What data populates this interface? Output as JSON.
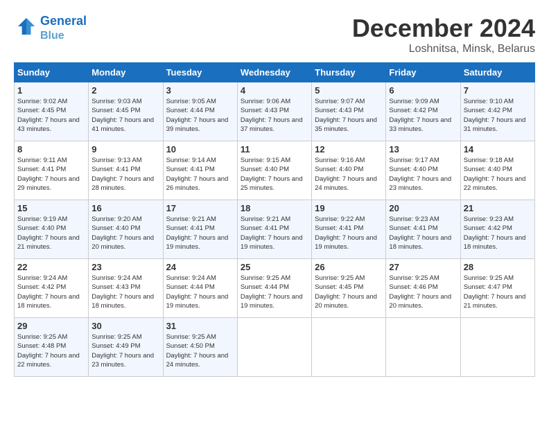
{
  "header": {
    "logo_line1": "General",
    "logo_line2": "Blue",
    "month": "December 2024",
    "location": "Loshnitsa, Minsk, Belarus"
  },
  "weekdays": [
    "Sunday",
    "Monday",
    "Tuesday",
    "Wednesday",
    "Thursday",
    "Friday",
    "Saturday"
  ],
  "weeks": [
    [
      {
        "day": "1",
        "sunrise": "Sunrise: 9:02 AM",
        "sunset": "Sunset: 4:45 PM",
        "daylight": "Daylight: 7 hours and 43 minutes."
      },
      {
        "day": "2",
        "sunrise": "Sunrise: 9:03 AM",
        "sunset": "Sunset: 4:45 PM",
        "daylight": "Daylight: 7 hours and 41 minutes."
      },
      {
        "day": "3",
        "sunrise": "Sunrise: 9:05 AM",
        "sunset": "Sunset: 4:44 PM",
        "daylight": "Daylight: 7 hours and 39 minutes."
      },
      {
        "day": "4",
        "sunrise": "Sunrise: 9:06 AM",
        "sunset": "Sunset: 4:43 PM",
        "daylight": "Daylight: 7 hours and 37 minutes."
      },
      {
        "day": "5",
        "sunrise": "Sunrise: 9:07 AM",
        "sunset": "Sunset: 4:43 PM",
        "daylight": "Daylight: 7 hours and 35 minutes."
      },
      {
        "day": "6",
        "sunrise": "Sunrise: 9:09 AM",
        "sunset": "Sunset: 4:42 PM",
        "daylight": "Daylight: 7 hours and 33 minutes."
      },
      {
        "day": "7",
        "sunrise": "Sunrise: 9:10 AM",
        "sunset": "Sunset: 4:42 PM",
        "daylight": "Daylight: 7 hours and 31 minutes."
      }
    ],
    [
      {
        "day": "8",
        "sunrise": "Sunrise: 9:11 AM",
        "sunset": "Sunset: 4:41 PM",
        "daylight": "Daylight: 7 hours and 29 minutes."
      },
      {
        "day": "9",
        "sunrise": "Sunrise: 9:13 AM",
        "sunset": "Sunset: 4:41 PM",
        "daylight": "Daylight: 7 hours and 28 minutes."
      },
      {
        "day": "10",
        "sunrise": "Sunrise: 9:14 AM",
        "sunset": "Sunset: 4:41 PM",
        "daylight": "Daylight: 7 hours and 26 minutes."
      },
      {
        "day": "11",
        "sunrise": "Sunrise: 9:15 AM",
        "sunset": "Sunset: 4:40 PM",
        "daylight": "Daylight: 7 hours and 25 minutes."
      },
      {
        "day": "12",
        "sunrise": "Sunrise: 9:16 AM",
        "sunset": "Sunset: 4:40 PM",
        "daylight": "Daylight: 7 hours and 24 minutes."
      },
      {
        "day": "13",
        "sunrise": "Sunrise: 9:17 AM",
        "sunset": "Sunset: 4:40 PM",
        "daylight": "Daylight: 7 hours and 23 minutes."
      },
      {
        "day": "14",
        "sunrise": "Sunrise: 9:18 AM",
        "sunset": "Sunset: 4:40 PM",
        "daylight": "Daylight: 7 hours and 22 minutes."
      }
    ],
    [
      {
        "day": "15",
        "sunrise": "Sunrise: 9:19 AM",
        "sunset": "Sunset: 4:40 PM",
        "daylight": "Daylight: 7 hours and 21 minutes."
      },
      {
        "day": "16",
        "sunrise": "Sunrise: 9:20 AM",
        "sunset": "Sunset: 4:40 PM",
        "daylight": "Daylight: 7 hours and 20 minutes."
      },
      {
        "day": "17",
        "sunrise": "Sunrise: 9:21 AM",
        "sunset": "Sunset: 4:41 PM",
        "daylight": "Daylight: 7 hours and 19 minutes."
      },
      {
        "day": "18",
        "sunrise": "Sunrise: 9:21 AM",
        "sunset": "Sunset: 4:41 PM",
        "daylight": "Daylight: 7 hours and 19 minutes."
      },
      {
        "day": "19",
        "sunrise": "Sunrise: 9:22 AM",
        "sunset": "Sunset: 4:41 PM",
        "daylight": "Daylight: 7 hours and 19 minutes."
      },
      {
        "day": "20",
        "sunrise": "Sunrise: 9:23 AM",
        "sunset": "Sunset: 4:41 PM",
        "daylight": "Daylight: 7 hours and 18 minutes."
      },
      {
        "day": "21",
        "sunrise": "Sunrise: 9:23 AM",
        "sunset": "Sunset: 4:42 PM",
        "daylight": "Daylight: 7 hours and 18 minutes."
      }
    ],
    [
      {
        "day": "22",
        "sunrise": "Sunrise: 9:24 AM",
        "sunset": "Sunset: 4:42 PM",
        "daylight": "Daylight: 7 hours and 18 minutes."
      },
      {
        "day": "23",
        "sunrise": "Sunrise: 9:24 AM",
        "sunset": "Sunset: 4:43 PM",
        "daylight": "Daylight: 7 hours and 18 minutes."
      },
      {
        "day": "24",
        "sunrise": "Sunrise: 9:24 AM",
        "sunset": "Sunset: 4:44 PM",
        "daylight": "Daylight: 7 hours and 19 minutes."
      },
      {
        "day": "25",
        "sunrise": "Sunrise: 9:25 AM",
        "sunset": "Sunset: 4:44 PM",
        "daylight": "Daylight: 7 hours and 19 minutes."
      },
      {
        "day": "26",
        "sunrise": "Sunrise: 9:25 AM",
        "sunset": "Sunset: 4:45 PM",
        "daylight": "Daylight: 7 hours and 20 minutes."
      },
      {
        "day": "27",
        "sunrise": "Sunrise: 9:25 AM",
        "sunset": "Sunset: 4:46 PM",
        "daylight": "Daylight: 7 hours and 20 minutes."
      },
      {
        "day": "28",
        "sunrise": "Sunrise: 9:25 AM",
        "sunset": "Sunset: 4:47 PM",
        "daylight": "Daylight: 7 hours and 21 minutes."
      }
    ],
    [
      {
        "day": "29",
        "sunrise": "Sunrise: 9:25 AM",
        "sunset": "Sunset: 4:48 PM",
        "daylight": "Daylight: 7 hours and 22 minutes."
      },
      {
        "day": "30",
        "sunrise": "Sunrise: 9:25 AM",
        "sunset": "Sunset: 4:49 PM",
        "daylight": "Daylight: 7 hours and 23 minutes."
      },
      {
        "day": "31",
        "sunrise": "Sunrise: 9:25 AM",
        "sunset": "Sunset: 4:50 PM",
        "daylight": "Daylight: 7 hours and 24 minutes."
      },
      null,
      null,
      null,
      null
    ]
  ]
}
